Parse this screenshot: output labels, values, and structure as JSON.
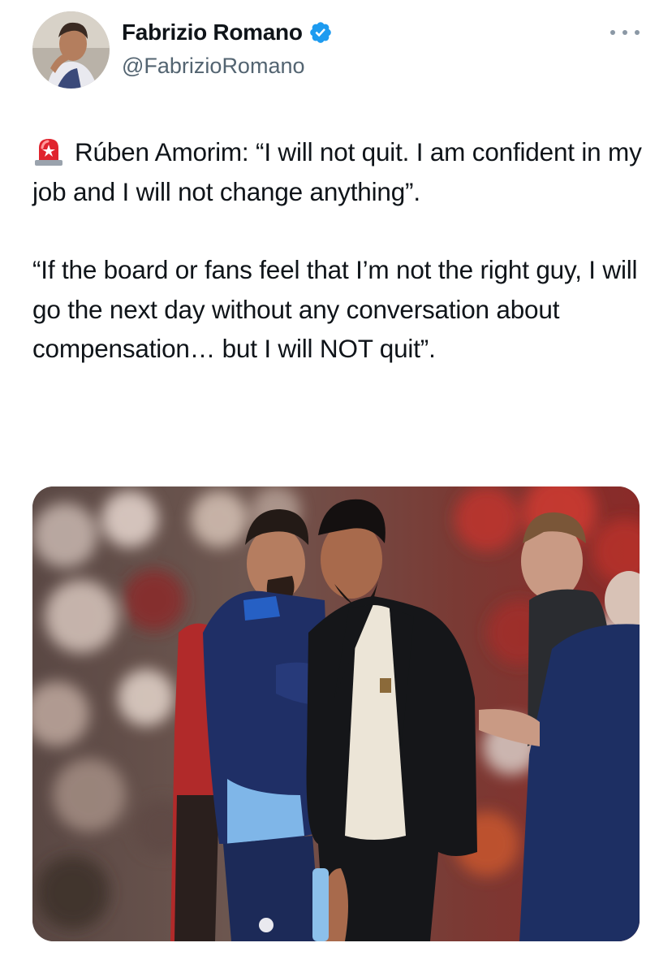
{
  "author": {
    "display_name": "Fabrizio Romano",
    "handle": "@FabrizioRomano",
    "verified": true,
    "avatar_icon": "profile-photo"
  },
  "more_icon": "more-horizontal-icon",
  "tweet": {
    "emoji": "rotating-light-siren",
    "paragraph_1": "Rúben Amorim: “I will not quit. I am confident in my job and I will not change anything”.",
    "paragraph_2": "“If the board or fans feel that I’m not the right guy, I will go the next day without any conversation about compensation… but I will NOT quit”."
  },
  "colors": {
    "text": "#0f1419",
    "secondary": "#536471",
    "verified": "#1d9bf0",
    "siren_red": "#e0242e"
  }
}
